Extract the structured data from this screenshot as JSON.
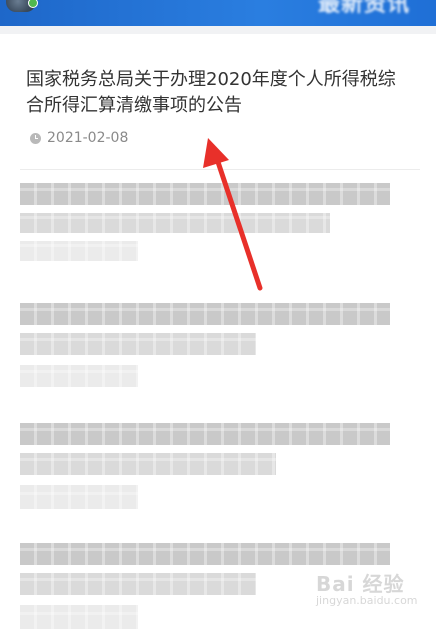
{
  "header": {
    "right_title": "最新资讯"
  },
  "article": {
    "title": "国家税务总局关于办理2020年度个人所得税综合所得汇算清缴事项的公告",
    "date": "2021-02-08"
  },
  "watermark": {
    "text": "Bai 经验",
    "sub": "jingyan.baidu.com"
  },
  "colors": {
    "header_blue": "#1f6fd6",
    "annotation_red": "#e8302a"
  },
  "icons": {
    "date": "clock-icon"
  }
}
